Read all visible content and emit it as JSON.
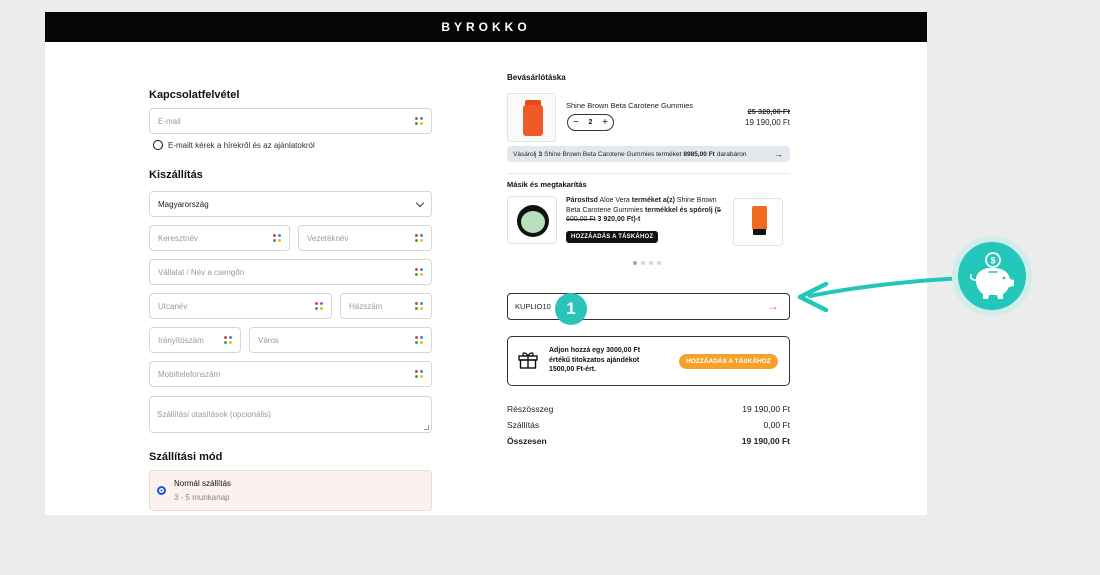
{
  "header": {
    "brand": "BYROKKO"
  },
  "contact": {
    "title": "Kapcsolatfelvétel",
    "email_placeholder": "E-mail",
    "newsletter_label": "E-mailt kérek a hírekről és az ajánlatokról"
  },
  "shipping": {
    "title": "Kiszállítás",
    "country": "Magyarország",
    "first_name": "Keresztnév",
    "last_name": "Vezetéknév",
    "company": "Vállalat / Név a csengőn",
    "street": "Utcanév",
    "house_number": "Házszám",
    "zip": "Irányítószám",
    "city": "Város",
    "phone": "Mobiltelefonszám",
    "notes": "Szállítási utasítások (opcionális)"
  },
  "shipping_method": {
    "title": "Szállítási mód",
    "option_name": "Normál szállítás",
    "option_sub": "3 - 5 munkanap"
  },
  "cart": {
    "title": "Bevásárlótáska",
    "product_name": "Shine Brown Beta Carotene Gummies",
    "quantity": "2",
    "minus": "−",
    "plus": "+",
    "price_old": "25 320,00 Ft",
    "price_new": "19 190,00 Ft",
    "promo_pre": "Vásárolj",
    "promo_qty": "3",
    "promo_mid": "Shine Brown Beta Carotene Gummies terméket",
    "promo_price": "8985,00 Ft",
    "promo_post": "darabáron",
    "promo_arrow": "→"
  },
  "upsell": {
    "title": "Másik és megtakarítás",
    "t1": "Párosítsd",
    "t2": "Aloe Vera",
    "t3": "terméket a(z)",
    "t4": "Shine Brown Beta Carotene Gummies",
    "t5": "termékkel",
    "t6": "és spórolj (",
    "old": "5 600,00 Ft",
    "new": "3 920,00 Ft",
    "t7": ")-t",
    "button": "HOZZÁADÁS A TÁSKÁHOZ"
  },
  "coupon": {
    "value": "KUPLIO10",
    "arrow": "→"
  },
  "gift": {
    "line1": "Adjon hozzá egy 3000,00 Ft",
    "line2": "értékű titokzatos ajándékot",
    "line3": "1500,00 Ft-ért.",
    "button": "HOZZÁADÁS A TÁSKÁHOZ"
  },
  "summary": {
    "subtotal_label": "Részösszeg",
    "subtotal_value": "19 190,00 Ft",
    "shipping_label": "Szállítás",
    "shipping_value": "0,00 Ft",
    "total_label": "Összesen",
    "total_value": "19 190,00 Ft"
  },
  "overlay": {
    "step_number": "1"
  },
  "colors": {
    "accent_teal": "#22c7b9",
    "orange": "#f7a12d",
    "radio_blue": "#1a57d6"
  }
}
